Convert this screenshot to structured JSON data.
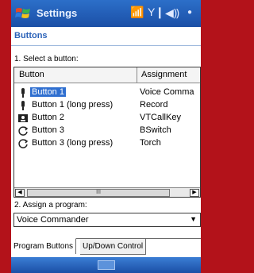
{
  "titlebar": {
    "title": "Settings",
    "icons": [
      "windows-start-icon",
      "antenna-icon",
      "signal-icon",
      "volume-icon",
      "ok-icon"
    ]
  },
  "page": {
    "heading": "Buttons",
    "select_label": "1. Select a button:",
    "assign_label": "2. Assign a program:"
  },
  "list": {
    "columns": [
      "Button",
      "Assignment"
    ],
    "rows": [
      {
        "name": "Button 1",
        "assignment": "Voice Comma",
        "icon": "button-1-icon",
        "selected": true
      },
      {
        "name": "Button 1 (long press)",
        "assignment": "Record",
        "icon": "button-1-icon",
        "selected": false
      },
      {
        "name": "Button 2",
        "assignment": "VTCallKey",
        "icon": "button-2-icon",
        "selected": false
      },
      {
        "name": "Button 3",
        "assignment": "BSwitch",
        "icon": "button-3-icon",
        "selected": false
      },
      {
        "name": "Button 3 (long press)",
        "assignment": "Torch",
        "icon": "button-3-icon",
        "selected": false
      }
    ]
  },
  "combo": {
    "value": "Voice Commander"
  },
  "tabs": [
    {
      "label": "Program Buttons",
      "active": true
    },
    {
      "label": "Up/Down Control",
      "active": false
    }
  ],
  "colors": {
    "titlebar": "#1b4fa6",
    "selection": "#2f6fd0",
    "frame": "#b3121a"
  }
}
